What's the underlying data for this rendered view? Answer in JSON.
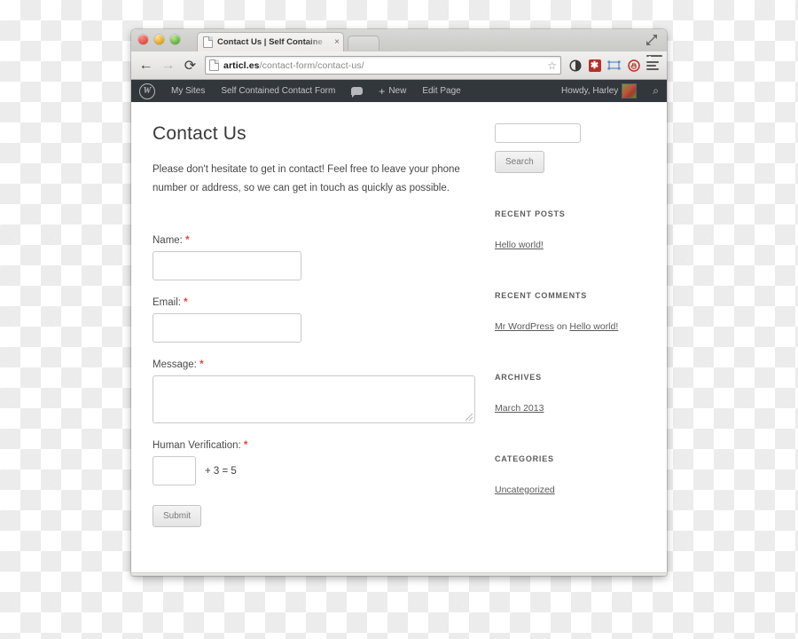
{
  "browser": {
    "tab": {
      "title": "Contact Us | Self Containe",
      "close_label": "×",
      "favicon_name": "page-favicon"
    },
    "toolbar": {
      "back_glyph": "←",
      "forward_glyph": "→",
      "reload_glyph": "⟳",
      "url_host": "articl.es",
      "url_path": "/contact-form/contact-us/",
      "star_glyph": "☆",
      "ext_ghostery_glyph": "◑",
      "ext_red_glyph": "✱",
      "ext_frame_glyph": "▭",
      "ext_adblock_glyph": "✋",
      "ext_menu_badge": "1"
    },
    "window_controls": {
      "close": "close",
      "minimize": "minimize",
      "zoom": "zoom",
      "fullscreen_glyph": "⤡"
    }
  },
  "wp_adminbar": {
    "logo": "W",
    "items": [
      {
        "label": "My Sites"
      },
      {
        "label": "Self Contained Contact Form"
      },
      {
        "label": ""
      },
      {
        "label": "New",
        "plus": "+"
      },
      {
        "label": "Edit Page"
      }
    ],
    "howdy": "Howdy, Harley",
    "search_glyph": "⌕"
  },
  "page": {
    "title": "Contact Us",
    "intro": "Please don't hesitate to get in contact! Feel free to leave your phone number or address, so we can get in touch as quickly as possible.",
    "form": {
      "name_label": "Name:",
      "email_label": "Email:",
      "message_label": "Message:",
      "verification_label": "Human Verification:",
      "required_mark": "*",
      "name_value": "",
      "email_value": "",
      "message_value": "",
      "captcha_value": "",
      "captcha_equation": "+ 3 = 5",
      "submit_label": "Submit"
    }
  },
  "sidebar": {
    "search": {
      "value": "",
      "button_label": "Search"
    },
    "widgets": [
      {
        "title": "Recent Posts",
        "links": [
          {
            "text": "Hello world!"
          }
        ]
      },
      {
        "title": "Recent Comments",
        "comment_author": "Mr WordPress",
        "comment_on": " on ",
        "comment_post": "Hello world!"
      },
      {
        "title": "Archives",
        "links": [
          {
            "text": "March 2013"
          }
        ]
      },
      {
        "title": "Categories",
        "links": [
          {
            "text": "Uncategorized"
          }
        ]
      }
    ]
  },
  "colors": {
    "adminbar": "#32373c",
    "required": "#e8453c",
    "link": "#5a5a5a"
  }
}
